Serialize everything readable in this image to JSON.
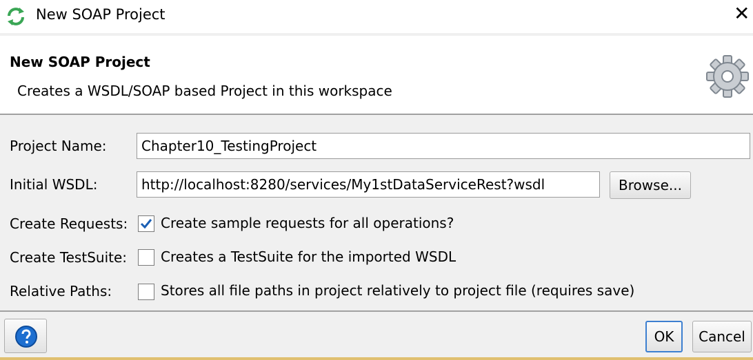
{
  "window": {
    "title": "New SOAP Project",
    "close_glyph": "✕"
  },
  "header": {
    "title": "New SOAP Project",
    "description": "Creates a WSDL/SOAP based Project in this workspace",
    "icon": "gear-icon"
  },
  "form": {
    "project_name": {
      "label": "Project Name:",
      "value": "Chapter10_TestingProject"
    },
    "initial_wsdl": {
      "label": "Initial WSDL:",
      "value": "http://localhost:8280/services/My1stDataServiceRest?wsdl",
      "browse_label": "Browse..."
    },
    "create_requests": {
      "label": "Create Requests:",
      "text": "Create sample requests for all operations?",
      "checked": true
    },
    "create_testsuite": {
      "label": "Create TestSuite:",
      "text": "Creates a TestSuite for the imported WSDL",
      "checked": false
    },
    "relative_paths": {
      "label": "Relative Paths:",
      "text": "Stores all file paths in project relatively to project file (requires save)",
      "checked": false
    }
  },
  "footer": {
    "help_icon": "help-icon",
    "ok_label": "OK",
    "cancel_label": "Cancel"
  },
  "colors": {
    "accent": "#1e6fd0",
    "soapui_green": "#3aa655",
    "check_blue": "#1a5fb4"
  }
}
